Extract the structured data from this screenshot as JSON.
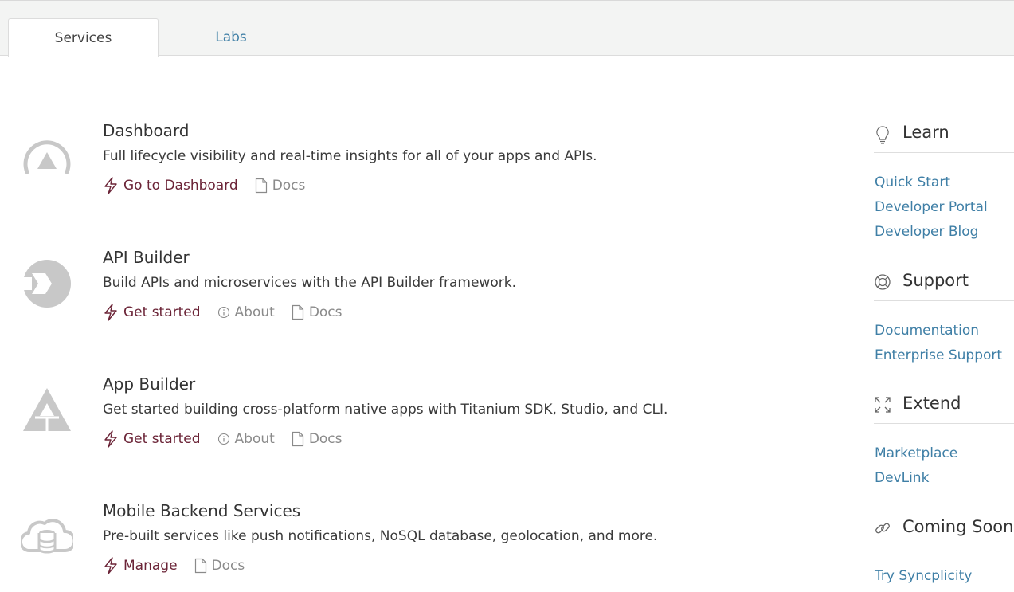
{
  "tabs": [
    {
      "label": "Services",
      "active": true
    },
    {
      "label": "Labs",
      "active": false
    }
  ],
  "services": [
    {
      "title": "Dashboard",
      "description": "Full lifecycle visibility and real-time insights for all of your apps and APIs.",
      "icon": "dashboard-gauge-icon",
      "actions": {
        "primary": "Go to Dashboard",
        "docs": "Docs"
      }
    },
    {
      "title": "API Builder",
      "description": "Build APIs and microservices with the API Builder framework.",
      "icon": "api-builder-icon",
      "actions": {
        "primary": "Get started",
        "about": "About",
        "docs": "Docs"
      }
    },
    {
      "title": "App Builder",
      "description": "Get started building cross-platform native apps with Titanium SDK, Studio, and CLI.",
      "icon": "app-builder-triangle-icon",
      "actions": {
        "primary": "Get started",
        "about": "About",
        "docs": "Docs"
      }
    },
    {
      "title": "Mobile Backend Services",
      "description": "Pre-built services like push notifications, NoSQL database, geolocation, and more.",
      "icon": "cloud-database-icon",
      "actions": {
        "primary": "Manage",
        "docs": "Docs"
      }
    }
  ],
  "sidebar": {
    "learn": {
      "title": "Learn",
      "icon": "lightbulb-icon",
      "links": [
        "Quick Start",
        "Developer Portal",
        "Developer Blog"
      ]
    },
    "support": {
      "title": "Support",
      "icon": "lifebuoy-icon",
      "links": [
        "Documentation",
        "Enterprise Support"
      ]
    },
    "extend": {
      "title": "Extend",
      "icon": "expand-arrows-icon",
      "links": [
        "Marketplace",
        "DevLink"
      ]
    },
    "coming_soon": {
      "title": "Coming Soon",
      "icon": "link-icon",
      "links": [
        "Try Syncplicity"
      ]
    }
  },
  "colors": {
    "primary_action": "#6b2437",
    "link": "#3f7fa6",
    "muted": "#8a8a8a",
    "icon_gray": "#c8c8c8",
    "tabbar_bg": "#f3f4f3"
  }
}
